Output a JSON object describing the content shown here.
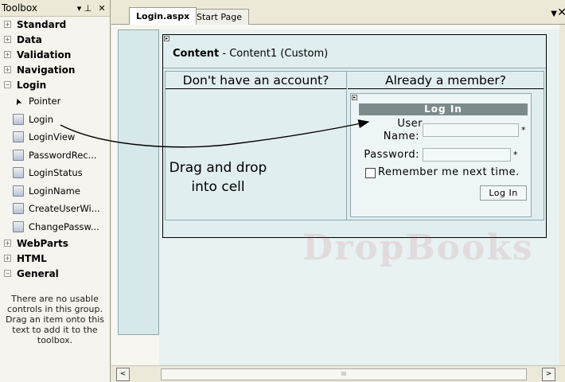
{
  "toolbox": {
    "title": "Toolbox",
    "pin_glyph": "▾ ⊥",
    "close_glyph": "✕",
    "groups_before": [
      {
        "sign": "+",
        "label": "Standard"
      },
      {
        "sign": "+",
        "label": "Data"
      },
      {
        "sign": "+",
        "label": "Validation"
      },
      {
        "sign": "+",
        "label": "Navigation"
      }
    ],
    "login_group": {
      "sign": "−",
      "label": "Login"
    },
    "login_items": [
      {
        "label": "Pointer",
        "icon": "pointer-icon"
      },
      {
        "label": "Login",
        "icon": "login-control-icon"
      },
      {
        "label": "LoginView",
        "icon": "loginview-icon"
      },
      {
        "label": "PasswordRec...",
        "icon": "passwordrecovery-icon"
      },
      {
        "label": "LoginStatus",
        "icon": "loginstatus-icon"
      },
      {
        "label": "LoginName",
        "icon": "loginname-icon"
      },
      {
        "label": "CreateUserWi...",
        "icon": "createuserwizard-icon"
      },
      {
        "label": "ChangePassw...",
        "icon": "changepassword-icon"
      }
    ],
    "groups_after": [
      {
        "sign": "+",
        "label": "WebParts"
      },
      {
        "sign": "+",
        "label": "HTML"
      },
      {
        "sign": "−",
        "label": "General"
      }
    ],
    "empty_text": "There are no usable controls in this group. Drag an item onto this text to add it to the toolbox."
  },
  "tabs": {
    "active": "Login.aspx",
    "inactive": "Start Page",
    "dropdown_glyph": "▼",
    "close_glyph": "✕"
  },
  "content": {
    "label_bold": "Content",
    "label_rest": " - Content1 (Custom)",
    "col_left": "Don't have an account?",
    "col_right": "Already a member?",
    "callout_line1": "Drag and drop",
    "callout_line2": "into cell"
  },
  "login_control": {
    "title": "Log In",
    "user_label_1": "User",
    "user_label_2": "Name:",
    "password_label": "Password:",
    "required_mark": "*",
    "remember_label": "Remember me next time.",
    "button_label": "Log In"
  },
  "scroll": {
    "left_glyph": "<",
    "right_glyph": ">",
    "thumb_grip": "III"
  },
  "watermark": "DropBooks",
  "colors": {
    "surface": "#e0eeef",
    "login_header": "#7d8a8c",
    "chrome": "#ece9d8"
  }
}
